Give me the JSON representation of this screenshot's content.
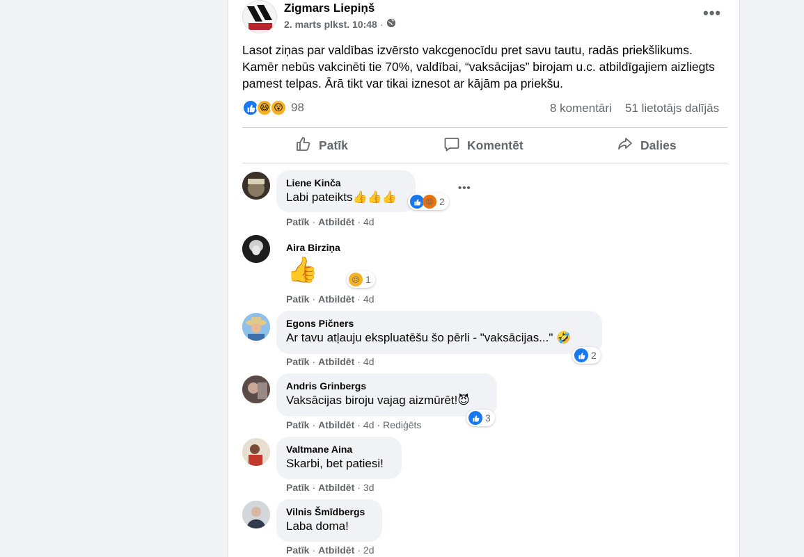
{
  "post": {
    "author": "Zigmars Liepiņš",
    "timestamp": "2. marts plkst. 10:48",
    "separator": "·",
    "text": "Lasot ziņas par valdības izvērsto vakcgenocīdu pret savu tautu, radās priekšlikums. Kamēr nebūs vakcinēti tie 70%, valdībai, “vaksācijas” birojam u.c. atbildīgajiem aizliegts pamest telpas. Ārā tikt var tikai iznesot ar kājām pa priekšu.",
    "reactions_count": "98",
    "comments_count": "8 komentāri",
    "shares_count": "51 lietotājs dalījās",
    "reaction_icons": [
      "like-icon",
      "haha-icon",
      "wow-icon"
    ]
  },
  "actions": {
    "like": "Patīk",
    "comment": "Komentēt",
    "share": "Dalies"
  },
  "comment_actions": {
    "like": "Patīk",
    "reply": "Atbildēt",
    "dot": "·"
  },
  "comments": [
    {
      "name": "Liene Kinča",
      "text": "Labi pateikts👍👍👍",
      "time": "4d",
      "reactions": "2",
      "reaction_icons": [
        "like-icon",
        "angry-icon"
      ]
    },
    {
      "name": "Aira Birziņa",
      "text": "👍",
      "time": "4d",
      "reactions": "1",
      "reaction_icons": [
        "sad-icon"
      ]
    },
    {
      "name": "Egons Pičners",
      "text": "Ar tavu atļauju ekspluatēšu šo pērli - \"vaksācijas...\" 🤣",
      "time": "4d",
      "reactions": "2",
      "reaction_icons": [
        "like-icon"
      ]
    },
    {
      "name": "Andris Grinbergs",
      "text": "Vaksācijas biroju vajag aizmūrēt!😈",
      "time": "4d",
      "edited": "Rediģēts",
      "reactions": "3",
      "reaction_icons": [
        "like-icon"
      ]
    },
    {
      "name": "Valtmane Aina",
      "text": "Skarbi, bet patiesi!",
      "time": "3d"
    },
    {
      "name": "Vilnis Šmīdbergs",
      "text": "Laba doma!",
      "time": "2d"
    }
  ],
  "colors": {
    "like_blue": "#1877f2",
    "secondary_text": "#65676b",
    "bubble_bg": "#f0f2f5",
    "page_bg": "#f0f2f5"
  }
}
